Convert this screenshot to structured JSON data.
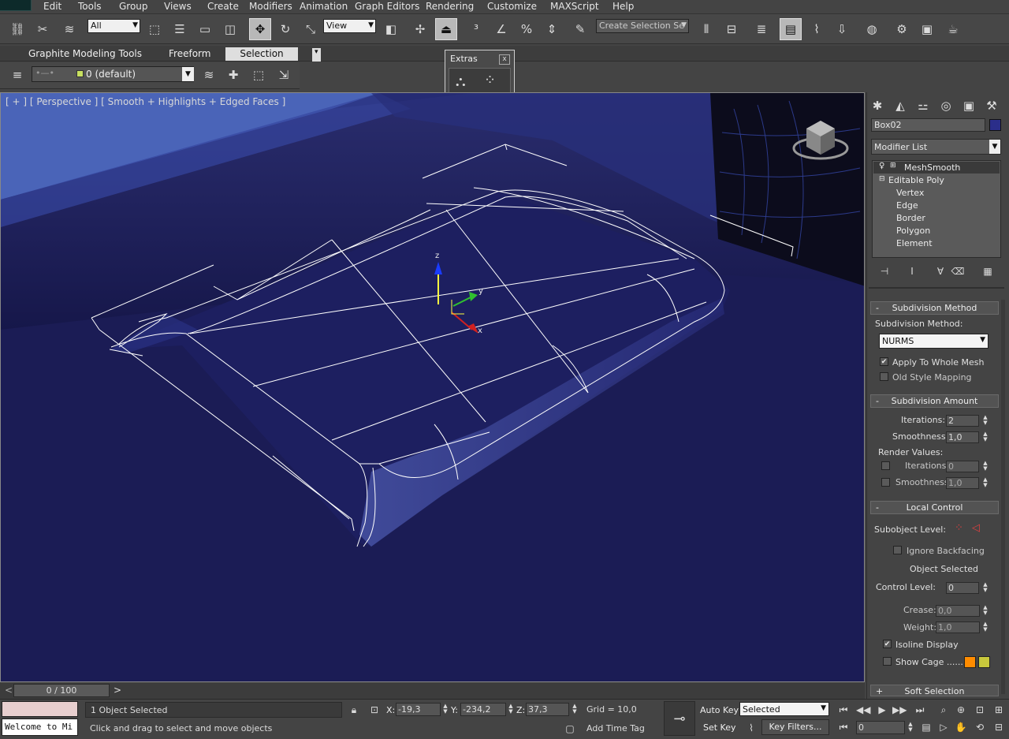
{
  "menu": {
    "items": [
      "Edit",
      "Tools",
      "Group",
      "Views",
      "Create",
      "Modifiers",
      "Animation",
      "Graph Editors",
      "Rendering",
      "Customize",
      "MAXScript",
      "Help"
    ]
  },
  "toolbar": {
    "filter_value": "All",
    "refcoord_value": "View",
    "named_selection_placeholder": "Create Selection Se"
  },
  "ribbon": {
    "tabs": [
      "Graphite Modeling Tools",
      "Freeform",
      "Selection"
    ],
    "active_tab": "Selection",
    "layer_value": "0 (default)"
  },
  "extras": {
    "title": "Extras",
    "close": "x"
  },
  "viewport": {
    "label": "[ + ] [ Perspective ] [ Smooth + Highlights + Edged Faces ]",
    "gizmo": {
      "z": "z",
      "y": "y",
      "x": "x"
    },
    "background_color": "#1b1c55"
  },
  "command_panel": {
    "object_name": "Box02",
    "object_color": "#2b2e8a",
    "modifier_list_label": "Modifier List",
    "stack": [
      {
        "label": "MeshSmooth",
        "level": 0,
        "selected": true
      },
      {
        "label": "Editable Poly",
        "level": 0,
        "selected": false
      },
      {
        "label": "Vertex",
        "level": 1
      },
      {
        "label": "Edge",
        "level": 1
      },
      {
        "label": "Border",
        "level": 1
      },
      {
        "label": "Polygon",
        "level": 1
      },
      {
        "label": "Element",
        "level": 1
      }
    ],
    "subdivision_method": {
      "header": "Subdivision Method",
      "label": "Subdivision Method:",
      "value": "NURMS",
      "apply_whole_mesh": "Apply To Whole Mesh",
      "apply_whole_mesh_checked": true,
      "old_style": "Old Style Mapping",
      "old_style_checked": false
    },
    "subdivision_amount": {
      "header": "Subdivision Amount",
      "iterations_label": "Iterations:",
      "iterations": "2",
      "smoothness_label": "Smoothness:",
      "smoothness": "1,0",
      "render_values_label": "Render Values:",
      "render_iterations_label": "Iterations:",
      "render_iterations": "0",
      "render_smoothness_label": "Smoothness:",
      "render_smoothness": "1,0"
    },
    "local_control": {
      "header": "Local Control",
      "subobject_label": "Subobject Level:",
      "ignore_backfacing": "Ignore Backfacing",
      "object_selected": "Object Selected",
      "control_level_label": "Control Level:",
      "control_level": "0",
      "crease_label": "Crease:",
      "crease": "0,0",
      "weight_label": "Weight:",
      "weight": "1,0",
      "isoline_display": "Isoline Display",
      "isoline_checked": true,
      "show_cage": "Show Cage ......",
      "show_cage_checked": false,
      "cage_color1": "#ff8c00",
      "cage_color2": "#c8c83c"
    },
    "soft_selection": {
      "header": "Soft Selection"
    }
  },
  "time_slider": {
    "value": "0 / 100",
    "prev": "<",
    "next": ">"
  },
  "status": {
    "listener_value": "Welcome to Mi",
    "selection_text": "1 Object Selected",
    "prompt_text": "Click and drag to select and move objects",
    "x_label": "X:",
    "x_value": "-19,3",
    "y_label": "Y:",
    "y_value": "-234,2",
    "z_label": "Z:",
    "z_value": "37,3",
    "grid_text": "Grid = 10,0",
    "auto_key": "Auto Key",
    "set_key": "Set Key",
    "key_mode_value": "Selected",
    "key_filters": "Key Filters...",
    "add_time_tag": "Add Time Tag",
    "frame_value": "0"
  }
}
